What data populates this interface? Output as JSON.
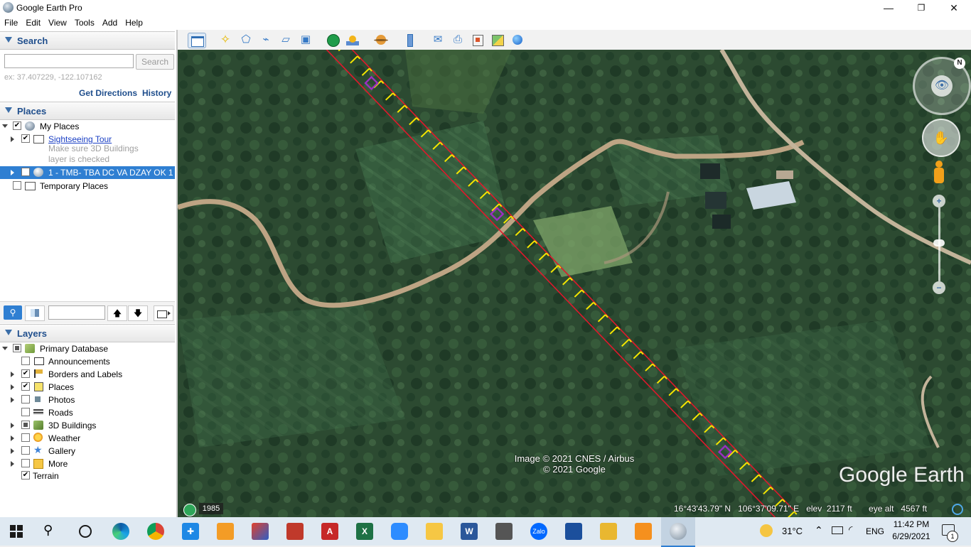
{
  "window": {
    "title": "Google Earth Pro",
    "minimize": "—",
    "maximize": "❐",
    "close": "✕"
  },
  "menu": [
    "File",
    "Edit",
    "View",
    "Tools",
    "Add",
    "Help"
  ],
  "search": {
    "header": "Search",
    "placeholder": "",
    "button": "Search",
    "hint": "ex: 37.407229, -122.107162",
    "get_directions": "Get Directions",
    "history": "History"
  },
  "places": {
    "header": "Places",
    "my_places": "My Places",
    "sightseeing": "Sightseeing Tour",
    "note_line1": "Make sure 3D Buildings",
    "note_line2": "layer is checked",
    "selected_item": "1 - TMB- TBA DC VA DZAY OK 1",
    "temporary": "Temporary Places"
  },
  "layers": {
    "header": "Layers",
    "primary": "Primary Database",
    "items": [
      "Announcements",
      "Borders and Labels",
      "Places",
      "Photos",
      "Roads",
      "3D Buildings",
      "Weather",
      "Gallery",
      "More",
      "Terrain"
    ]
  },
  "map": {
    "attribution_line1": "Image © 2021 CNES / Airbus",
    "attribution_line2": "© 2021 Google",
    "brand": "Google Earth",
    "year": "1985",
    "lat": "16°43'43.79\" N",
    "lon": "106°37'09.71\" E",
    "elev_label": "elev",
    "elev_value": "2117 ft",
    "eye_label": "eye alt",
    "eye_value": "4567 ft",
    "compass_north": "N"
  },
  "taskbar": {
    "temperature": "31°C",
    "language": "ENG",
    "time": "11:42 PM",
    "date": "6/29/2021",
    "notifications": "1"
  },
  "colors": {
    "accent": "#3b6ea8",
    "selected_row": "#2f7fd2",
    "path_line": "#e0182c",
    "path_marker": "#f5e600",
    "waypoint": "#9b2fc2"
  }
}
